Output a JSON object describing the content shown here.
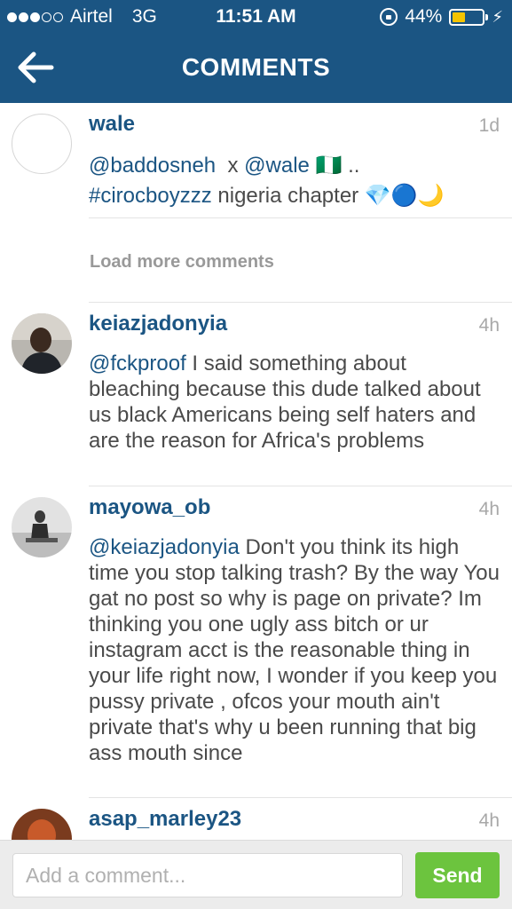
{
  "status_bar": {
    "carrier": "Airtel",
    "network": "3G",
    "time": "11:51 AM",
    "battery_percent_label": "44%",
    "battery_level": 0.44,
    "signal_bars_filled": 3,
    "signal_bars_total": 5
  },
  "header": {
    "title": "COMMENTS",
    "back_icon": "arrow-left-icon",
    "background_color": "#1b5583"
  },
  "caption": {
    "username": "wale",
    "time": "1d",
    "line1_mentions": [
      "@baddosneh",
      "@wale"
    ],
    "line1_sep": "x",
    "line1_tail": "🇳🇬 ..",
    "hashtag": "#cirocboyzzz",
    "line2_text": "nigeria chapter",
    "emojis": "💎🔵🌙"
  },
  "load_more_label": "Load more comments",
  "comments": [
    {
      "username": "keiazjadonyia",
      "time": "4h",
      "mention": "@fckproof",
      "text": "I said something about bleaching because this dude talked about us black Americans being self haters and are the reason for Africa's problems"
    },
    {
      "username": "mayowa_ob",
      "time": "4h",
      "mention": "@keiazjadonyia",
      "text": "Don't you think its high time you stop talking trash? By the way You gat no post so why is page on private? Im thinking you one ugly ass bitch or ur instagram acct is the reasonable thing in your life right now, I wonder if you keep you pussy private , ofcos your mouth ain't private that's why u been running that big ass mouth since"
    },
    {
      "username": "asap_marley23",
      "time": "4h"
    }
  ],
  "composer": {
    "placeholder": "Add a comment...",
    "value": "",
    "send_label": "Send",
    "send_color": "#6cc43e"
  }
}
